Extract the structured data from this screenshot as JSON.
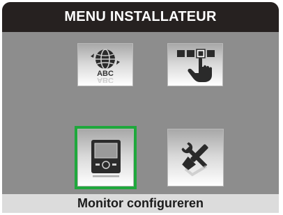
{
  "header": {
    "title": "MENU INSTALLATEUR"
  },
  "tiles": [
    {
      "name": "language",
      "icon": "globe-abc-icon",
      "text": "ABC"
    },
    {
      "name": "touch-settings",
      "icon": "hand-touch-icon"
    },
    {
      "name": "monitor-config",
      "icon": "monitor-icon",
      "selected": true
    },
    {
      "name": "tools",
      "icon": "wrench-screwdriver-icon"
    }
  ],
  "selection_color": "#1fa83c",
  "footer": {
    "label": "Monitor configureren"
  }
}
